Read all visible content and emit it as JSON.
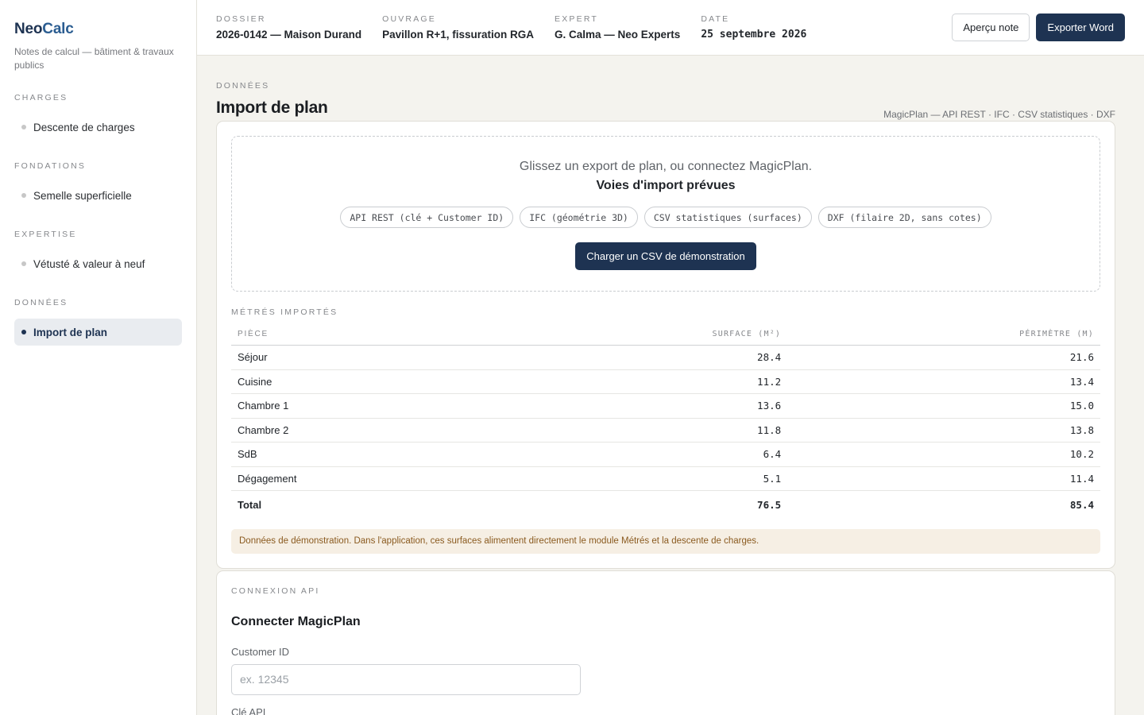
{
  "app": {
    "brand_a": "Neo",
    "brand_b": "Calc",
    "subtitle": "Notes de calcul — bâtiment & travaux publics"
  },
  "sidebar": {
    "groups": [
      {
        "title": "CHARGES",
        "items": [
          {
            "label": "Descente de charges",
            "active": false
          }
        ]
      },
      {
        "title": "FONDATIONS",
        "items": [
          {
            "label": "Semelle superficielle",
            "active": false
          }
        ]
      },
      {
        "title": "EXPERTISE",
        "items": [
          {
            "label": "Vétusté & valeur à neuf",
            "active": false
          }
        ]
      },
      {
        "title": "DONNÉES",
        "items": [
          {
            "label": "Import de plan",
            "active": true
          }
        ]
      }
    ]
  },
  "header": {
    "dossier": {
      "label": "DOSSIER",
      "value": "2026-0142 — Maison Durand"
    },
    "ouvrage": {
      "label": "OUVRAGE",
      "value": "Pavillon R+1, fissuration RGA"
    },
    "expert": {
      "label": "EXPERT",
      "value": "G. Calma — Neo Experts"
    },
    "date": {
      "label": "DATE",
      "value": "25 septembre 2026"
    },
    "preview_button": "Aperçu note",
    "export_button": "Exporter Word"
  },
  "main": {
    "kicker": "DONNÉES",
    "title": "Import de plan",
    "sources": "MagicPlan — API REST · IFC · CSV statistiques · DXF",
    "dropzone": {
      "line1": "Glissez un export de plan, ou connectez MagicPlan.",
      "line2": "Voies d'import prévues",
      "chips": [
        "API REST (clé + Customer ID)",
        "IFC (géométrie 3D)",
        "CSV statistiques (surfaces)",
        "DXF (filaire 2D, sans cotes)"
      ],
      "demo_button": "Charger un CSV de démonstration"
    },
    "metres": {
      "kicker": "MÉTRÉS IMPORTÉS",
      "columns": [
        "PIÈCE",
        "SURFACE (M²)",
        "PÉRIMÈTRE (M)"
      ],
      "rows": [
        {
          "piece": "Séjour",
          "surface": "28.4",
          "perimetre": "21.6"
        },
        {
          "piece": "Cuisine",
          "surface": "11.2",
          "perimetre": "13.4"
        },
        {
          "piece": "Chambre 1",
          "surface": "13.6",
          "perimetre": "15.0"
        },
        {
          "piece": "Chambre 2",
          "surface": "11.8",
          "perimetre": "13.8"
        },
        {
          "piece": "SdB",
          "surface": "6.4",
          "perimetre": "10.2"
        },
        {
          "piece": "Dégagement",
          "surface": "5.1",
          "perimetre": "11.4"
        }
      ],
      "total": {
        "piece": "Total",
        "surface": "76.5",
        "perimetre": "85.4"
      },
      "notice": "Données de démonstration. Dans l'application, ces surfaces alimentent directement le module Métrés et la descente de charges."
    },
    "api": {
      "kicker": "CONNEXION API",
      "title": "Connecter MagicPlan",
      "customer_id_label": "Customer ID",
      "customer_id_placeholder": "ex. 12345",
      "api_key_label": "Clé API"
    }
  },
  "colors": {
    "primary": "#1e3352",
    "background": "#f4f3ee",
    "notice_bg": "#f6efe4",
    "notice_text": "#8a5a1f"
  }
}
